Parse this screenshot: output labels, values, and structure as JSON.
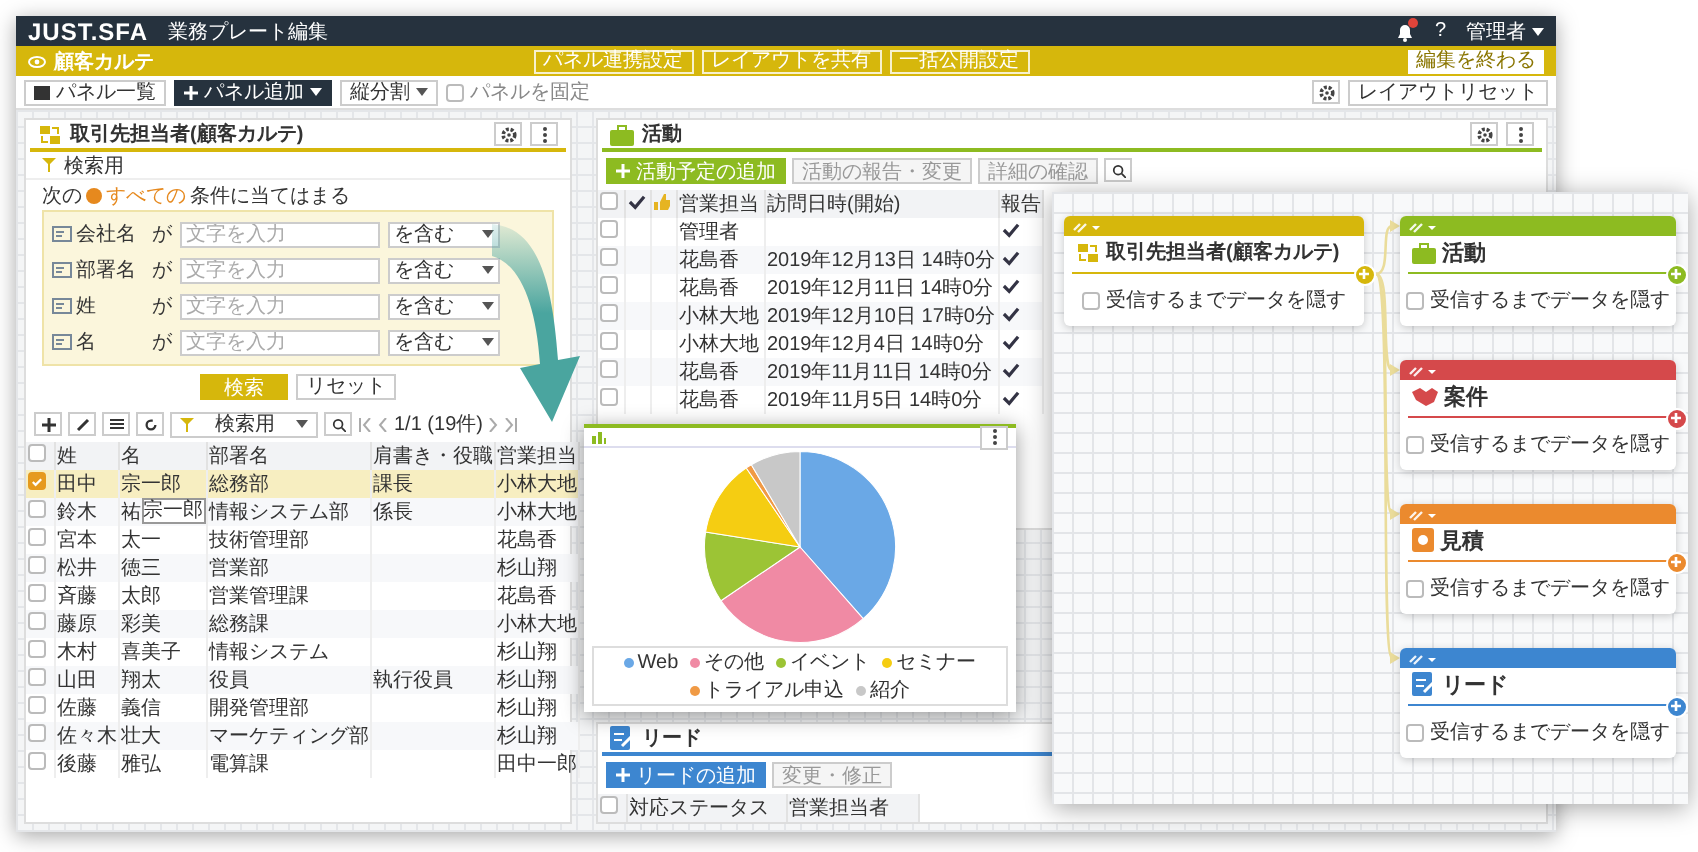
{
  "header": {
    "logo": "JUST.SFA",
    "title": "業務プレート編集",
    "help": "?",
    "user": "管理者"
  },
  "plate_bar": {
    "title": "顧客カルテ",
    "actions": [
      "パネル連携設定",
      "レイアウトを共有",
      "一括公開設定"
    ],
    "finish": "編集を終わる"
  },
  "toolbar": {
    "panel_list": "パネル一覧",
    "add_panel": "パネル追加",
    "split": "縦分割",
    "lock_label": "パネルを固定",
    "lock_checked": false,
    "reset": "レイアウトリセット"
  },
  "contact_panel": {
    "title": "取引先担当者(顧客カルテ)",
    "search_title": "検索用",
    "condition_prefix": "次の",
    "condition_match": "すべての",
    "condition_suffix": "条件に当てはまる",
    "filters": [
      {
        "label": "会社名",
        "particle": "が",
        "placeholder": "文字を入力",
        "operator": "を含む"
      },
      {
        "label": "部署名",
        "particle": "が",
        "placeholder": "文字を入力",
        "operator": "を含む"
      },
      {
        "label": "姓",
        "particle": "が",
        "placeholder": "文字を入力",
        "operator": "を含む"
      },
      {
        "label": "名",
        "particle": "が",
        "placeholder": "文字を入力",
        "operator": "を含む"
      }
    ],
    "search_button": "検索",
    "reset_button": "リセット",
    "view": "検索用",
    "pagination": "1/1 (19件)",
    "columns": [
      "姓",
      "名",
      "部署名",
      "肩書き・役職",
      "営業担当"
    ],
    "all_selected": false,
    "rows": [
      {
        "cells": [
          "田中",
          "宗一郎",
          "総務部",
          "課長",
          "小林大地"
        ],
        "selected": true
      },
      {
        "cells": [
          "鈴木",
          "祐",
          "情報システム部",
          "係長",
          "小林大地"
        ],
        "selected": false
      },
      {
        "cells": [
          "宮本",
          "太一",
          "技術管理部",
          "",
          "花島香"
        ],
        "selected": false
      },
      {
        "cells": [
          "松井",
          "徳三",
          "営業部",
          "",
          "杉山翔"
        ],
        "selected": false
      },
      {
        "cells": [
          "斉藤",
          "太郎",
          "営業管理課",
          "",
          "花島香"
        ],
        "selected": false
      },
      {
        "cells": [
          "藤原",
          "彩美",
          "総務課",
          "",
          "小林大地"
        ],
        "selected": false
      },
      {
        "cells": [
          "木村",
          "喜美子",
          "情報システム",
          "",
          "杉山翔"
        ],
        "selected": false
      },
      {
        "cells": [
          "山田",
          "翔太",
          "役員",
          "執行役員",
          "杉山翔"
        ],
        "selected": false
      },
      {
        "cells": [
          "佐藤",
          "義信",
          "開発管理部",
          "",
          "杉山翔"
        ],
        "selected": false
      },
      {
        "cells": [
          "佐々木",
          "壮大",
          "マーケティング部",
          "",
          "杉山翔"
        ],
        "selected": false
      },
      {
        "cells": [
          "後藤",
          "雅弘",
          "電算課",
          "",
          "田中一郎"
        ],
        "selected": false
      }
    ],
    "tooltip": "宗一郎"
  },
  "activity_panel": {
    "title": "活動",
    "buttons": [
      {
        "label": "活動予定の追加",
        "kind": "primary"
      },
      {
        "label": "活動の報告・変更",
        "kind": "disabled"
      },
      {
        "label": "詳細の確認",
        "kind": "disabled"
      }
    ],
    "columns": [
      "営業担当",
      "訪問日時(開始)",
      "報告"
    ],
    "all_selected": false,
    "rows": [
      {
        "rep": "管理者",
        "date": "",
        "reported": true,
        "selected": false
      },
      {
        "rep": "花島香",
        "date": "2019年12月13日 14時0分",
        "reported": true,
        "selected": false
      },
      {
        "rep": "花島香",
        "date": "2019年12月11日 14時0分",
        "reported": true,
        "selected": false
      },
      {
        "rep": "小林大地",
        "date": "2019年12月10日 17時0分",
        "reported": true,
        "selected": false
      },
      {
        "rep": "小林大地",
        "date": "2019年12月4日 14時0分",
        "reported": true,
        "selected": false
      },
      {
        "rep": "花島香",
        "date": "2019年11月11日 14時0分",
        "reported": true,
        "selected": false
      },
      {
        "rep": "花島香",
        "date": "2019年11月5日 14時0分",
        "reported": true,
        "selected": false
      }
    ]
  },
  "lead_panel": {
    "title": "リード",
    "buttons": [
      {
        "label": "リードの追加",
        "kind": "primary"
      },
      {
        "label": "変更・修正",
        "kind": "disabled"
      }
    ],
    "columns": [
      "対応ステータス",
      "営業担当者"
    ],
    "all_selected": false
  },
  "chart_window": {
    "legend": [
      {
        "label": "Web",
        "color": "#6aa8e6"
      },
      {
        "label": "その他",
        "color": "#f08aa4"
      },
      {
        "label": "イベント",
        "color": "#9cc435"
      },
      {
        "label": "セミナー",
        "color": "#f5cd12"
      },
      {
        "label": "トライアル申込",
        "color": "#f09a45"
      },
      {
        "label": "紹介",
        "color": "#c8c8c8"
      }
    ]
  },
  "flow": {
    "source": {
      "title": "取引先担当者(顧客カルテ)",
      "color": "#d6b70c",
      "hide_label": "受信するまでデータを隠す",
      "hide_checked": false
    },
    "targets": [
      {
        "title": "活動",
        "kind": "activity",
        "color": "#8dbb21",
        "hide_label": "受信するまでデータを隠す",
        "hide_checked": false
      },
      {
        "title": "案件",
        "kind": "deal",
        "color": "#d5494b",
        "hide_label": "受信するまでデータを隠す",
        "hide_checked": false
      },
      {
        "title": "見積",
        "kind": "quote",
        "color": "#eb8a2e",
        "hide_label": "受信するまでデータを隠す",
        "hide_checked": false
      },
      {
        "title": "リード",
        "kind": "lead",
        "color": "#3d86d0",
        "hide_label": "受信するまでデータを隠す",
        "hide_checked": false
      }
    ]
  }
}
